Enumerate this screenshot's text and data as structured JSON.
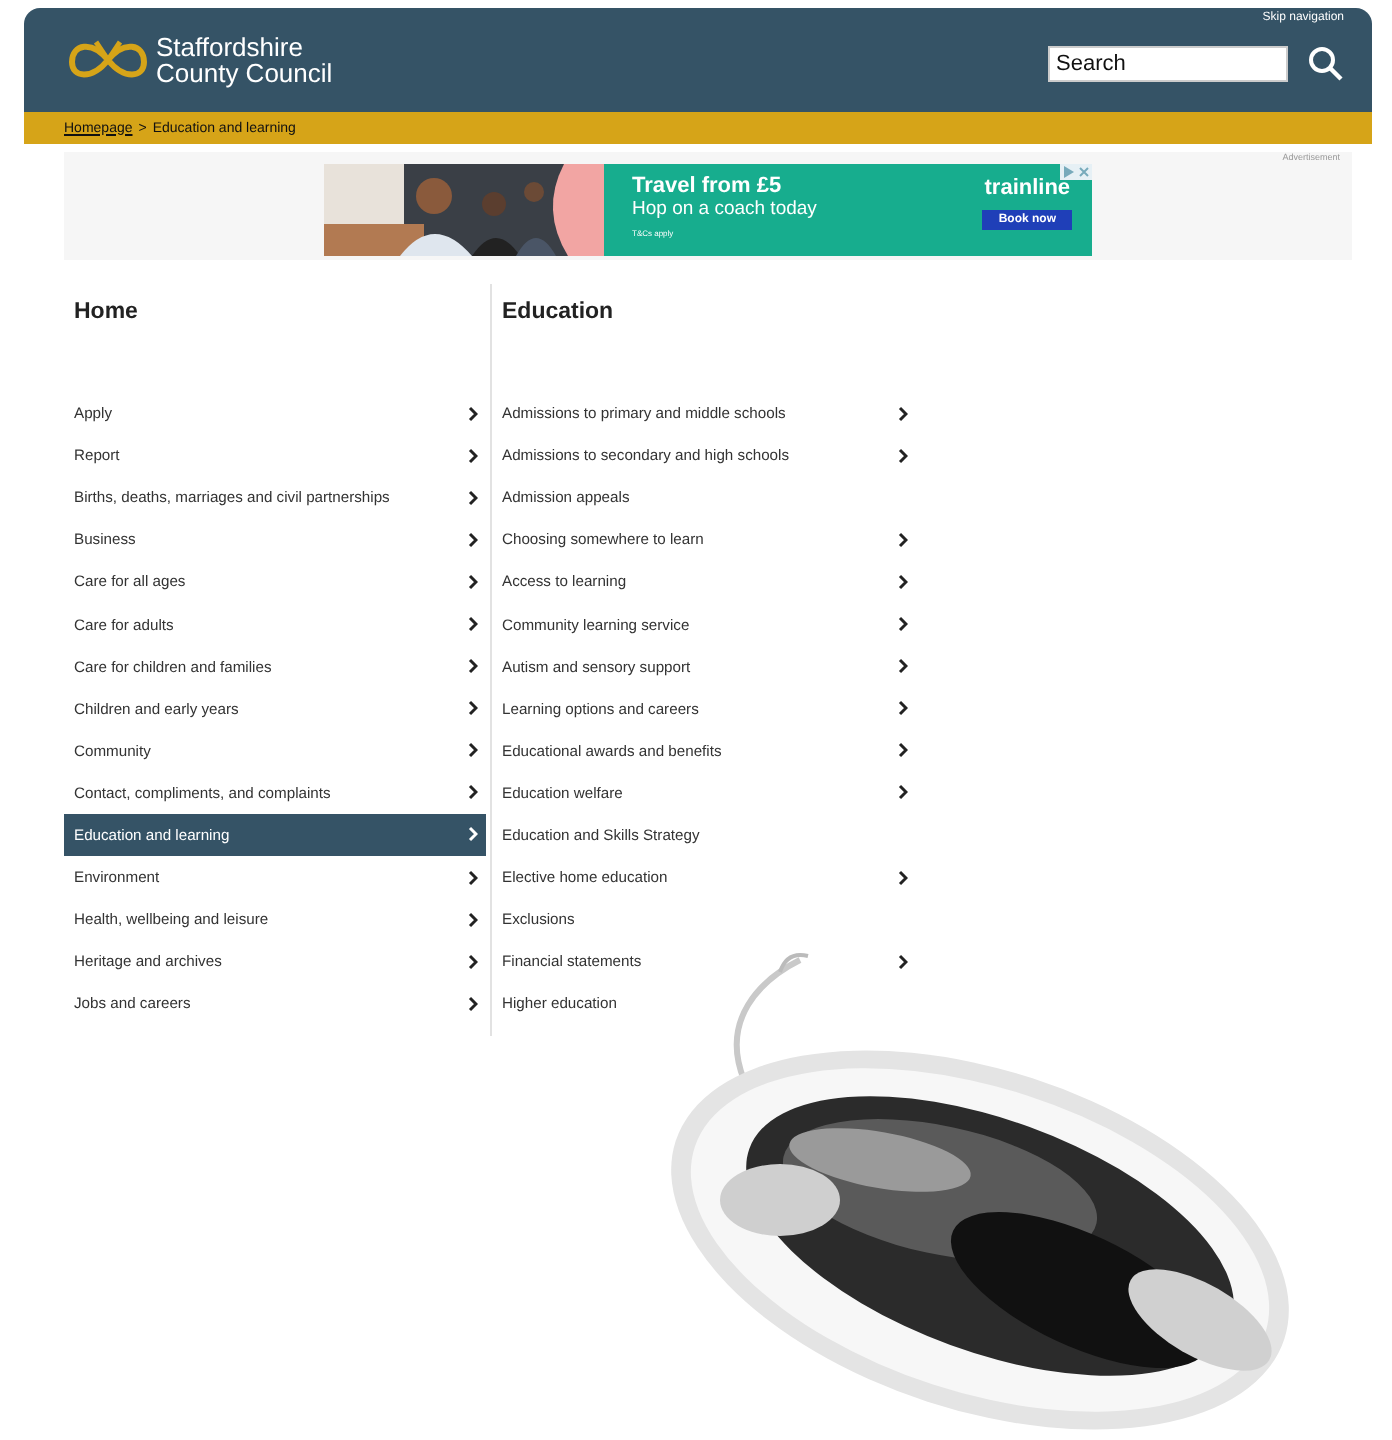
{
  "header": {
    "logo_line1": "Staffordshire",
    "logo_line2": "County Council",
    "skip_link": "Skip navigation",
    "search": {
      "placeholder": "Search"
    }
  },
  "breadcrumb": {
    "link": "Homepage",
    "separator": ">",
    "current": "Education and learning"
  },
  "advert": {
    "label": "Advertisement",
    "headline": "Travel from £5",
    "subline": "Hop on a coach today",
    "terms": "T&Cs apply",
    "brand": "trainline",
    "button": "Book now"
  },
  "left_menu": {
    "title": "Home",
    "items": [
      {
        "label": "Apply",
        "selected": false,
        "has_submenu": true
      },
      {
        "label": "Report",
        "selected": false,
        "has_submenu": true
      },
      {
        "label": "Births, deaths, marriages and civil partnerships",
        "selected": false,
        "has_submenu": true
      },
      {
        "label": "Business",
        "selected": false,
        "has_submenu": true
      },
      {
        "label": "Care for all ages",
        "selected": false,
        "has_submenu": true
      },
      {
        "label": "Care for adults",
        "selected": false,
        "has_submenu": true
      },
      {
        "label": "Care for children and families",
        "selected": false,
        "has_submenu": true
      },
      {
        "label": "Children and early years",
        "selected": false,
        "has_submenu": true
      },
      {
        "label": "Community",
        "selected": false,
        "has_submenu": true
      },
      {
        "label": "Contact, compliments, and complaints",
        "selected": false,
        "has_submenu": true
      },
      {
        "label": "Education and learning",
        "selected": true,
        "has_submenu": true
      },
      {
        "label": "Environment",
        "selected": false,
        "has_submenu": true
      },
      {
        "label": "Health, wellbeing and leisure",
        "selected": false,
        "has_submenu": true
      },
      {
        "label": "Heritage and archives",
        "selected": false,
        "has_submenu": true
      },
      {
        "label": "Jobs and careers",
        "selected": false,
        "has_submenu": true
      }
    ]
  },
  "right_menu": {
    "title": "Education",
    "items": [
      {
        "label": "Admissions to primary and middle schools",
        "selected": false,
        "has_submenu": true
      },
      {
        "label": "Admissions to secondary and high schools",
        "selected": false,
        "has_submenu": true
      },
      {
        "label": "Admission appeals",
        "selected": false,
        "has_submenu": false
      },
      {
        "label": "Choosing somewhere to learn",
        "selected": false,
        "has_submenu": true
      },
      {
        "label": "Access to learning",
        "selected": false,
        "has_submenu": true
      },
      {
        "label": "Community learning service",
        "selected": false,
        "has_submenu": true
      },
      {
        "label": "Autism and sensory support",
        "selected": false,
        "has_submenu": true
      },
      {
        "label": "Learning options and careers",
        "selected": false,
        "has_submenu": true
      },
      {
        "label": "Educational awards and benefits",
        "selected": false,
        "has_submenu": true
      },
      {
        "label": "Education welfare",
        "selected": false,
        "has_submenu": true
      },
      {
        "label": "Education and Skills Strategy",
        "selected": false,
        "has_submenu": false
      },
      {
        "label": "Elective home education",
        "selected": false,
        "has_submenu": true
      },
      {
        "label": "Exclusions",
        "selected": false,
        "has_submenu": false
      },
      {
        "label": "Financial statements",
        "selected": false,
        "has_submenu": true
      },
      {
        "label": "Higher education",
        "selected": false,
        "has_submenu": false
      }
    ]
  }
}
